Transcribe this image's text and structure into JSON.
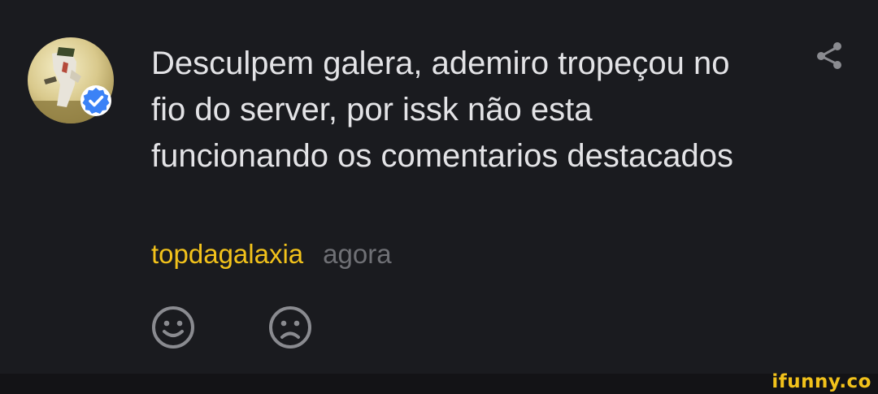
{
  "comment": {
    "text": "Desculpem galera, ademiro tropeçou no fio do server, por issk não esta funcionando os comentarios destacados",
    "username": "topdagalaxia",
    "timestamp": "agora",
    "verified": true
  },
  "actions": {
    "share_icon": "share-icon",
    "like_icon": "smile-icon",
    "dislike_icon": "frown-icon"
  },
  "watermark": {
    "text": "ifunny.co"
  },
  "colors": {
    "background": "#1a1b1f",
    "text": "#e3e3e6",
    "username": "#f2c21b",
    "muted": "#6f7075",
    "verified": "#3b82f6"
  }
}
